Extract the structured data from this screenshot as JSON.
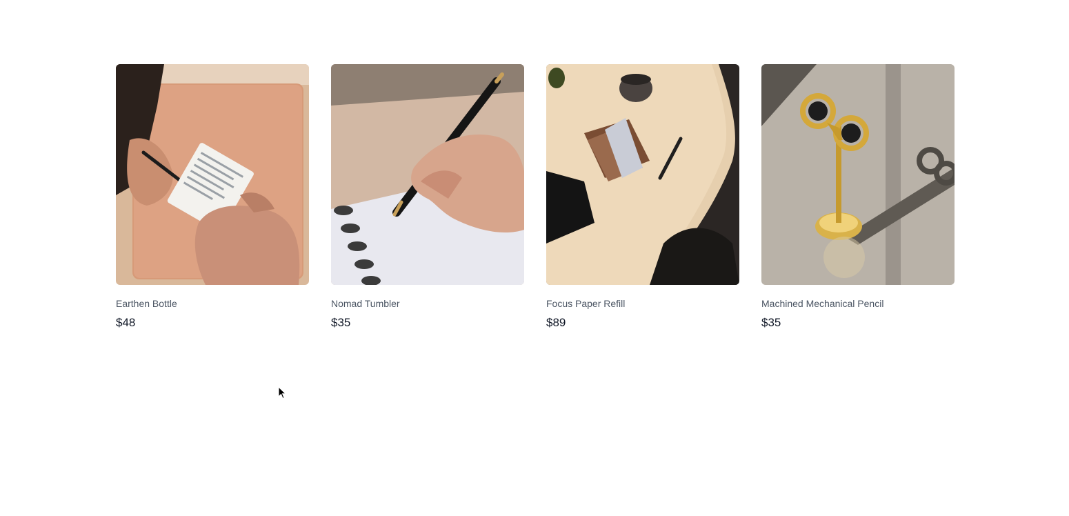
{
  "products": [
    {
      "name": "Earthen Bottle",
      "price": "$48",
      "image_icon": "notepad-writing-image"
    },
    {
      "name": "Nomad Tumbler",
      "price": "$35",
      "image_icon": "pen-notebook-image"
    },
    {
      "name": "Focus Paper Refill",
      "price": "$89",
      "image_icon": "desk-card-holder-image"
    },
    {
      "name": "Machined Mechanical Pencil",
      "price": "$35",
      "image_icon": "brass-scissors-image"
    }
  ]
}
